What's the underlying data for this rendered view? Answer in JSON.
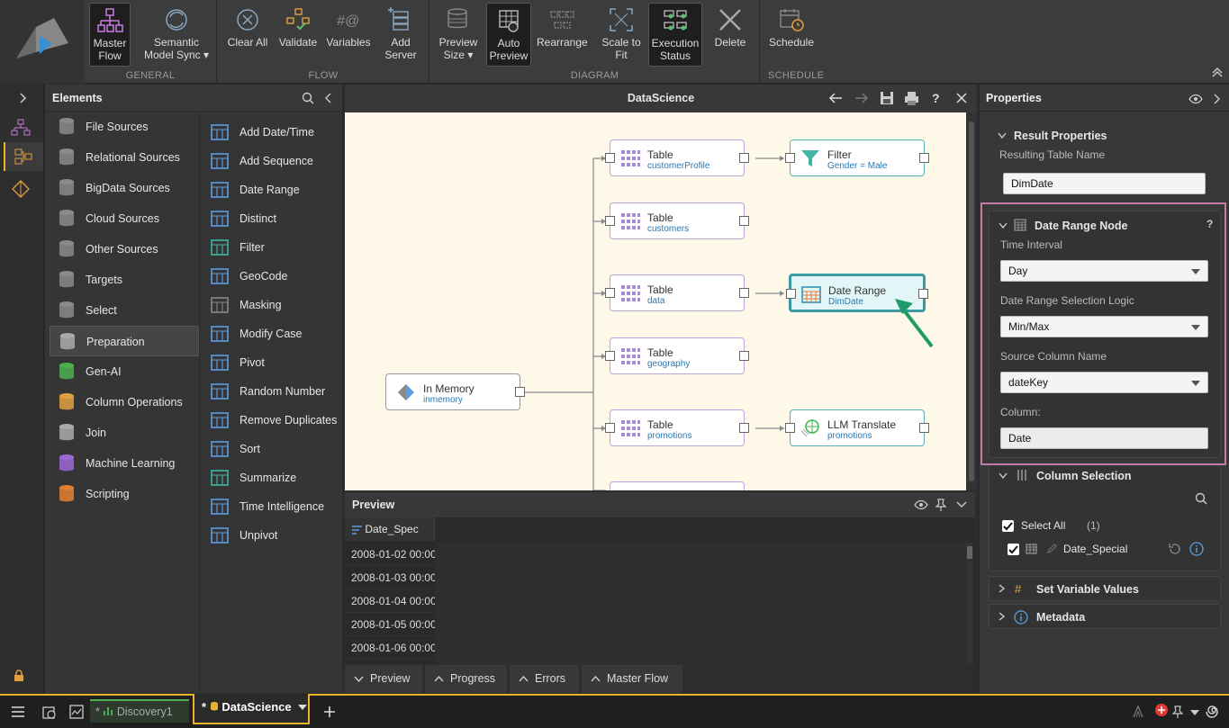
{
  "ribbon": {
    "groups": [
      {
        "label": "GENERAL"
      },
      {
        "label": "FLOW"
      },
      {
        "label": "DIAGRAM"
      },
      {
        "label": "SCHEDULE"
      }
    ],
    "buttons": {
      "master_flow": "Master\nFlow",
      "semantic_sync": "Semantic\nModel Sync ▾",
      "clear_all": "Clear All",
      "validate": "Validate",
      "variables": "Variables",
      "add_server": "Add\nServer",
      "preview_size": "Preview\nSize ▾",
      "auto_preview": "Auto\nPreview",
      "rearrange": "Rearrange",
      "scale_fit": "Scale to\nFit",
      "exec_status": "Execution\nStatus",
      "delete": "Delete",
      "schedule": "Schedule"
    }
  },
  "elements": {
    "title": "Elements",
    "categories": [
      "File Sources",
      "Relational Sources",
      "BigData Sources",
      "Cloud Sources",
      "Other Sources",
      "Targets",
      "Select",
      "Preparation",
      "Gen-AI",
      "Column Operations",
      "Join",
      "Machine Learning",
      "Scripting"
    ],
    "items": [
      "Add Date/Time",
      "Add Sequence",
      "Date Range",
      "Distinct",
      "Filter",
      "GeoCode",
      "Masking",
      "Modify Case",
      "Pivot",
      "Random Number",
      "Remove Duplicates",
      "Sort",
      "Summarize",
      "Time Intelligence",
      "Unpivot"
    ]
  },
  "canvas": {
    "title": "DataScience",
    "nodes": {
      "inmem": {
        "title": "In Memory",
        "sub": "inmemory"
      },
      "t1": {
        "title": "Table",
        "sub": "customerProfile"
      },
      "t2": {
        "title": "Table",
        "sub": "customers"
      },
      "t3": {
        "title": "Table",
        "sub": "data"
      },
      "t4": {
        "title": "Table",
        "sub": "geography"
      },
      "t5": {
        "title": "Table",
        "sub": "promotions"
      },
      "filter": {
        "title": "Filter",
        "sub": "Gender = Male"
      },
      "daterange": {
        "title": "Date Range",
        "sub": "DimDate"
      },
      "llm": {
        "title": "LLM Translate",
        "sub": "promotions"
      }
    }
  },
  "preview": {
    "title": "Preview",
    "column": "Date_Spec",
    "rows": [
      "2008-01-02 00:00",
      "2008-01-03 00:00",
      "2008-01-04 00:00",
      "2008-01-05 00:00",
      "2008-01-06 00:00"
    ]
  },
  "bottom_tabs": [
    "Preview",
    "Progress",
    "Errors",
    "Master Flow"
  ],
  "properties": {
    "title": "Properties",
    "result": {
      "header": "Result Properties",
      "label": "Resulting Table Name",
      "value": "DimDate"
    },
    "node": {
      "header": "Date Range Node",
      "help": "?",
      "time_interval_label": "Time Interval",
      "time_interval": "Day",
      "logic_label": "Date Range Selection Logic",
      "logic": "Min/Max",
      "source_label": "Source Column Name",
      "source": "dateKey",
      "column_label": "Column:",
      "column": "Date"
    },
    "column_selection": {
      "header": "Column Selection",
      "select_all": "Select All",
      "count": "(1)",
      "col": "Date_Special"
    },
    "set_variable": "Set Variable Values",
    "metadata": "Metadata"
  },
  "taskbar": {
    "tab1": "Discovery1",
    "tab1_prefix": "*",
    "tab2": "DataScience",
    "tab2_prefix": "*"
  },
  "colors": {
    "accent": "#e7b42b",
    "highlight": "#c77ca8",
    "node_sel": "#3a9a9f"
  }
}
